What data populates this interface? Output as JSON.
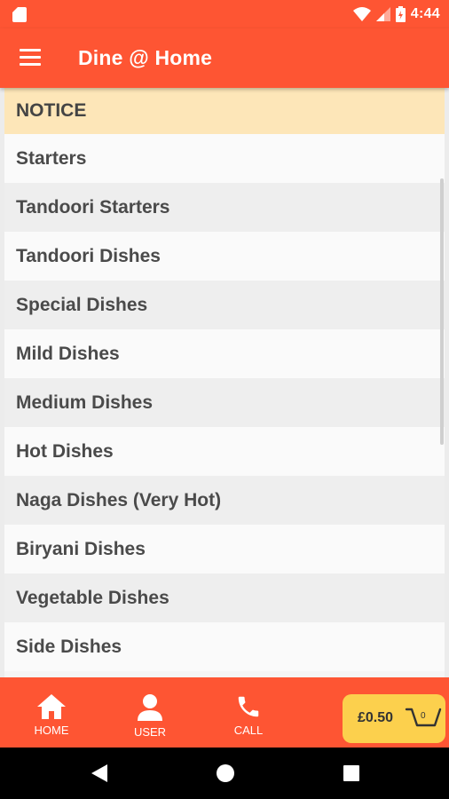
{
  "status_bar": {
    "time": "4:44"
  },
  "app_bar": {
    "title": "Dine @ Home",
    "menu_icon": "hamburger-menu-icon"
  },
  "categories": [
    {
      "label": "NOTICE",
      "style": "notice"
    },
    {
      "label": "Starters"
    },
    {
      "label": "Tandoori Starters"
    },
    {
      "label": "Tandoori Dishes"
    },
    {
      "label": "Special Dishes"
    },
    {
      "label": "Mild Dishes"
    },
    {
      "label": "Medium Dishes"
    },
    {
      "label": "Hot Dishes"
    },
    {
      "label": "Naga Dishes (Very Hot)"
    },
    {
      "label": "Biryani Dishes"
    },
    {
      "label": "Vegetable Dishes"
    },
    {
      "label": "Side Dishes"
    }
  ],
  "bottom_nav": {
    "home": {
      "label": "HOME",
      "icon": "home-icon"
    },
    "user": {
      "label": "USER",
      "icon": "user-icon"
    },
    "call": {
      "label": "CALL",
      "icon": "phone-icon"
    }
  },
  "cart": {
    "total": "£0.50",
    "count": "0",
    "icon": "basket-icon"
  },
  "colors": {
    "primary": "#fe5533",
    "notice_bg": "#fde6b8",
    "cart_bg": "#fcd04d"
  }
}
